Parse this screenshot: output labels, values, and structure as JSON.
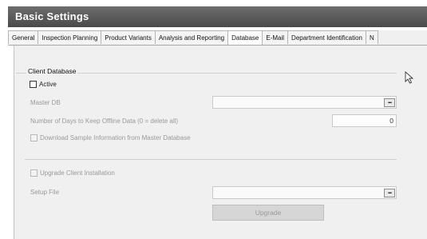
{
  "window": {
    "title": "Basic Settings"
  },
  "tabs": [
    {
      "label": "General"
    },
    {
      "label": "Inspection Planning"
    },
    {
      "label": "Product Variants"
    },
    {
      "label": "Analysis and Reporting"
    },
    {
      "label": "Database"
    },
    {
      "label": "E-Mail"
    },
    {
      "label": "Department Identification"
    },
    {
      "label": "N"
    }
  ],
  "active_tab": "Database",
  "client_database": {
    "group_title": "Client Database",
    "active_label": "Active",
    "active_checked": false,
    "master_db_label": "Master DB",
    "master_db_value": "",
    "browse_label": "...",
    "offline_days_label": "Number of Days to Keep Offline Data (0 = delete all)",
    "offline_days_value": "0",
    "download_sample_label": "Download Sample Information from Master Database",
    "upgrade_client_label": "Upgrade Client Installation",
    "setup_file_label": "Setup File",
    "setup_file_value": "",
    "upgrade_button_label": "Upgrade"
  }
}
